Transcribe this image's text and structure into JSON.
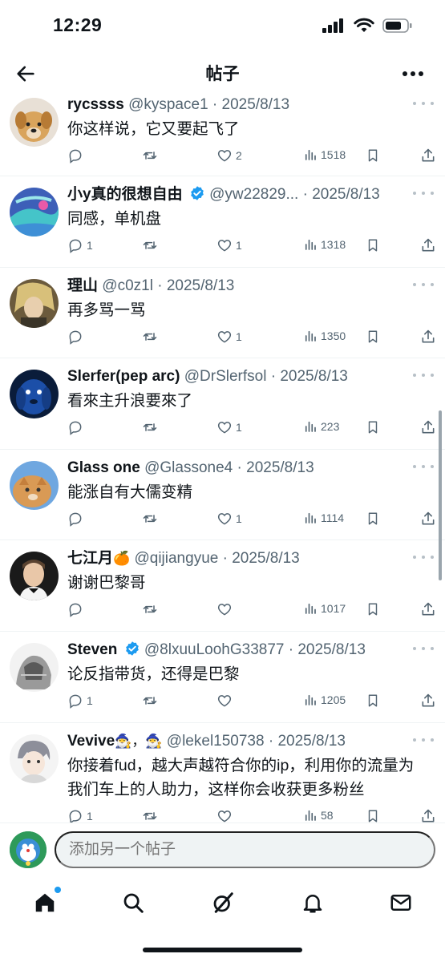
{
  "status": {
    "time": "12:29"
  },
  "nav": {
    "title": "帖子"
  },
  "replies": [
    {
      "name": "rycssss",
      "handle": "@kyspace1",
      "date": "· 2025/8/13",
      "text": "你这样说，它又要起飞了",
      "replies": "",
      "reposts": "",
      "likes": "2",
      "views": "1518"
    },
    {
      "name": "小y真的很想自由",
      "handle": "@yw22829...",
      "date": "· 2025/8/13",
      "text": "同感，单机盘",
      "replies": "1",
      "reposts": "",
      "likes": "1",
      "views": "1318"
    },
    {
      "name": "理山",
      "handle": "@c0z1l",
      "date": "· 2025/8/13",
      "text": "再多骂一骂",
      "replies": "",
      "reposts": "",
      "likes": "1",
      "views": "1350"
    },
    {
      "name": "Slerfer(pep arc)",
      "handle": "@DrSlerfsol",
      "date": "· 2025/8/13",
      "text": "看來主升浪要來了",
      "replies": "",
      "reposts": "",
      "likes": "1",
      "views": "223"
    },
    {
      "name": "Glass one",
      "handle": "@Glassone4",
      "date": "· 2025/8/13",
      "text": "能涨自有大儒变精",
      "replies": "",
      "reposts": "",
      "likes": "1",
      "views": "1114"
    },
    {
      "name": "七江月",
      "name_emoji": "🍊",
      "handle": "@qijiangyue",
      "date": "· 2025/8/13",
      "text": "谢谢巴黎哥",
      "replies": "",
      "reposts": "",
      "likes": "",
      "views": "1017"
    },
    {
      "name": "Steven",
      "handle": "@8lxuuLoohG33877",
      "date": "· 2025/8/13",
      "text": "论反指带货，还得是巴黎",
      "replies": "1",
      "reposts": "",
      "likes": "",
      "views": "1205"
    },
    {
      "name": "Vevive",
      "name_emoji": "🧙‍♂️，🧙‍♂️",
      "handle": "@lekel150738",
      "date": "· 2025/8/13",
      "text": "你接着fud，越大声越符合你的ip，利用你的流量为我们车上的人助力，这样你会收获更多粉丝",
      "replies": "1",
      "reposts": "",
      "likes": "",
      "views": "58"
    }
  ],
  "composer": {
    "placeholder": "添加另一个帖子"
  },
  "icons": {
    "back": "arrow-left-icon",
    "more": "more-horizontal-icon",
    "reply": "comment-icon",
    "repost": "repost-icon",
    "like": "heart-icon",
    "views": "bar-chart-icon",
    "bookmark": "bookmark-icon",
    "share": "share-icon",
    "tabs": [
      "home-icon",
      "search-icon",
      "grok-icon",
      "bell-icon",
      "mail-icon"
    ]
  },
  "colors": {
    "accent": "#1d9bf0",
    "text": "#0f1419",
    "secondary": "#536471"
  }
}
